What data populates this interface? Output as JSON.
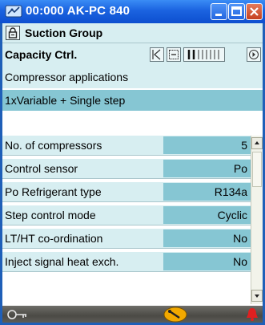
{
  "window": {
    "title": "00:000 AK-PC 840",
    "icons": {
      "app": "network-icon",
      "minimize": "minimize-icon",
      "maximize": "maximize-icon",
      "close": "close-icon"
    }
  },
  "group": {
    "title": "Suction Group",
    "icon": "lock-icon"
  },
  "capacity": {
    "label": "Capacity Ctrl.",
    "controls": [
      "first-page-icon",
      "zoom-out-icon",
      "level-bars-icon",
      "next-icon"
    ]
  },
  "applications": {
    "title": "Compressor applications",
    "value": "1xVariable + Single step"
  },
  "settings": [
    {
      "label": "No. of compressors",
      "value": "5"
    },
    {
      "label": "Control sensor",
      "value": "Po"
    },
    {
      "label": "Po Refrigerant type",
      "value": "R134a"
    },
    {
      "label": "Step control mode",
      "value": "Cyclic"
    },
    {
      "label": "LT/HT co-ordination",
      "value": "No"
    },
    {
      "label": "Inject signal heat exch.",
      "value": "No"
    }
  ],
  "statusbar": {
    "icons": [
      "key-icon",
      "wrench-icon",
      "alarm-bell-icon"
    ]
  },
  "colors": {
    "titlebar": "#1b63e0",
    "row_bg": "#d7eef1",
    "value_bg": "#86c6d3",
    "alarm": "#e02020",
    "wrench": "#f2a900"
  }
}
